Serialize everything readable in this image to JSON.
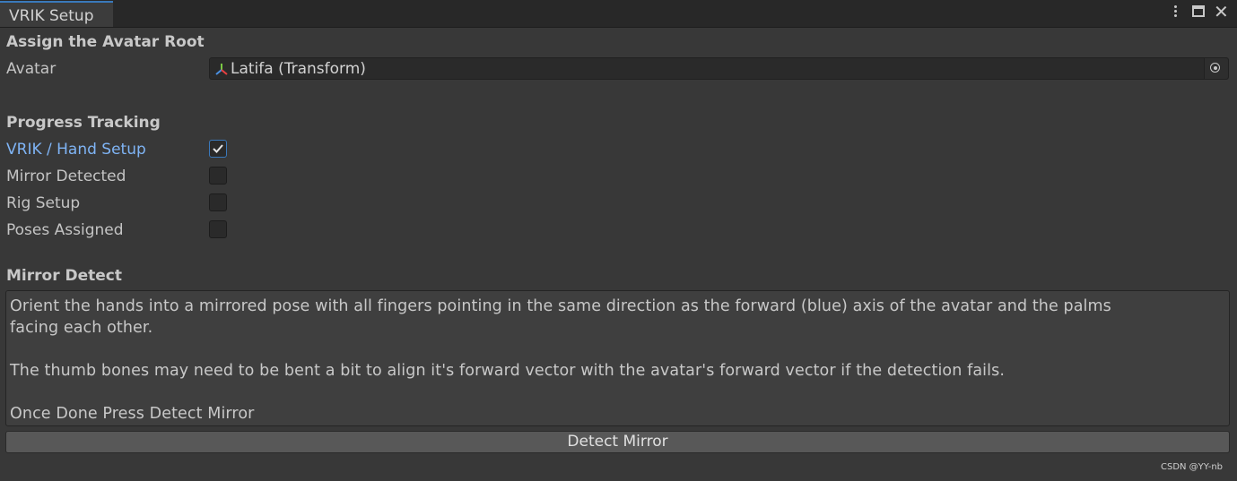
{
  "window": {
    "tab_title": "VRIK Setup",
    "icons": [
      "kebab-menu-icon",
      "maximize-icon",
      "close-icon"
    ]
  },
  "avatar_section": {
    "title": "Assign the Avatar Root",
    "field_label": "Avatar",
    "field_value": "Latifa (Transform)",
    "value_icon": "transform-axes-icon",
    "picker_icon": "object-picker-icon"
  },
  "progress_section": {
    "title": "Progress Tracking",
    "items": [
      {
        "label": "VRIK / Hand Setup",
        "checked": true
      },
      {
        "label": "Mirror Detected",
        "checked": false
      },
      {
        "label": "Rig Setup",
        "checked": false
      },
      {
        "label": "Poses Assigned",
        "checked": false
      }
    ]
  },
  "mirror_section": {
    "title": "Mirror Detect",
    "help_lines": [
      "Orient the hands into a mirrored pose with all fingers pointing in the same direction as the forward (blue) axis of the avatar and the palms",
      "facing each other.",
      "",
      "The thumb bones may need to be bent a bit to align it's forward vector with the avatar's forward vector if the detection fails.",
      "",
      "Once Done Press Detect Mirror"
    ],
    "button_label": "Detect Mirror"
  },
  "watermark": "CSDN @YY-nb",
  "colors": {
    "background": "#383838",
    "accent": "#3a79bb",
    "active_label": "#7fb4f5"
  }
}
